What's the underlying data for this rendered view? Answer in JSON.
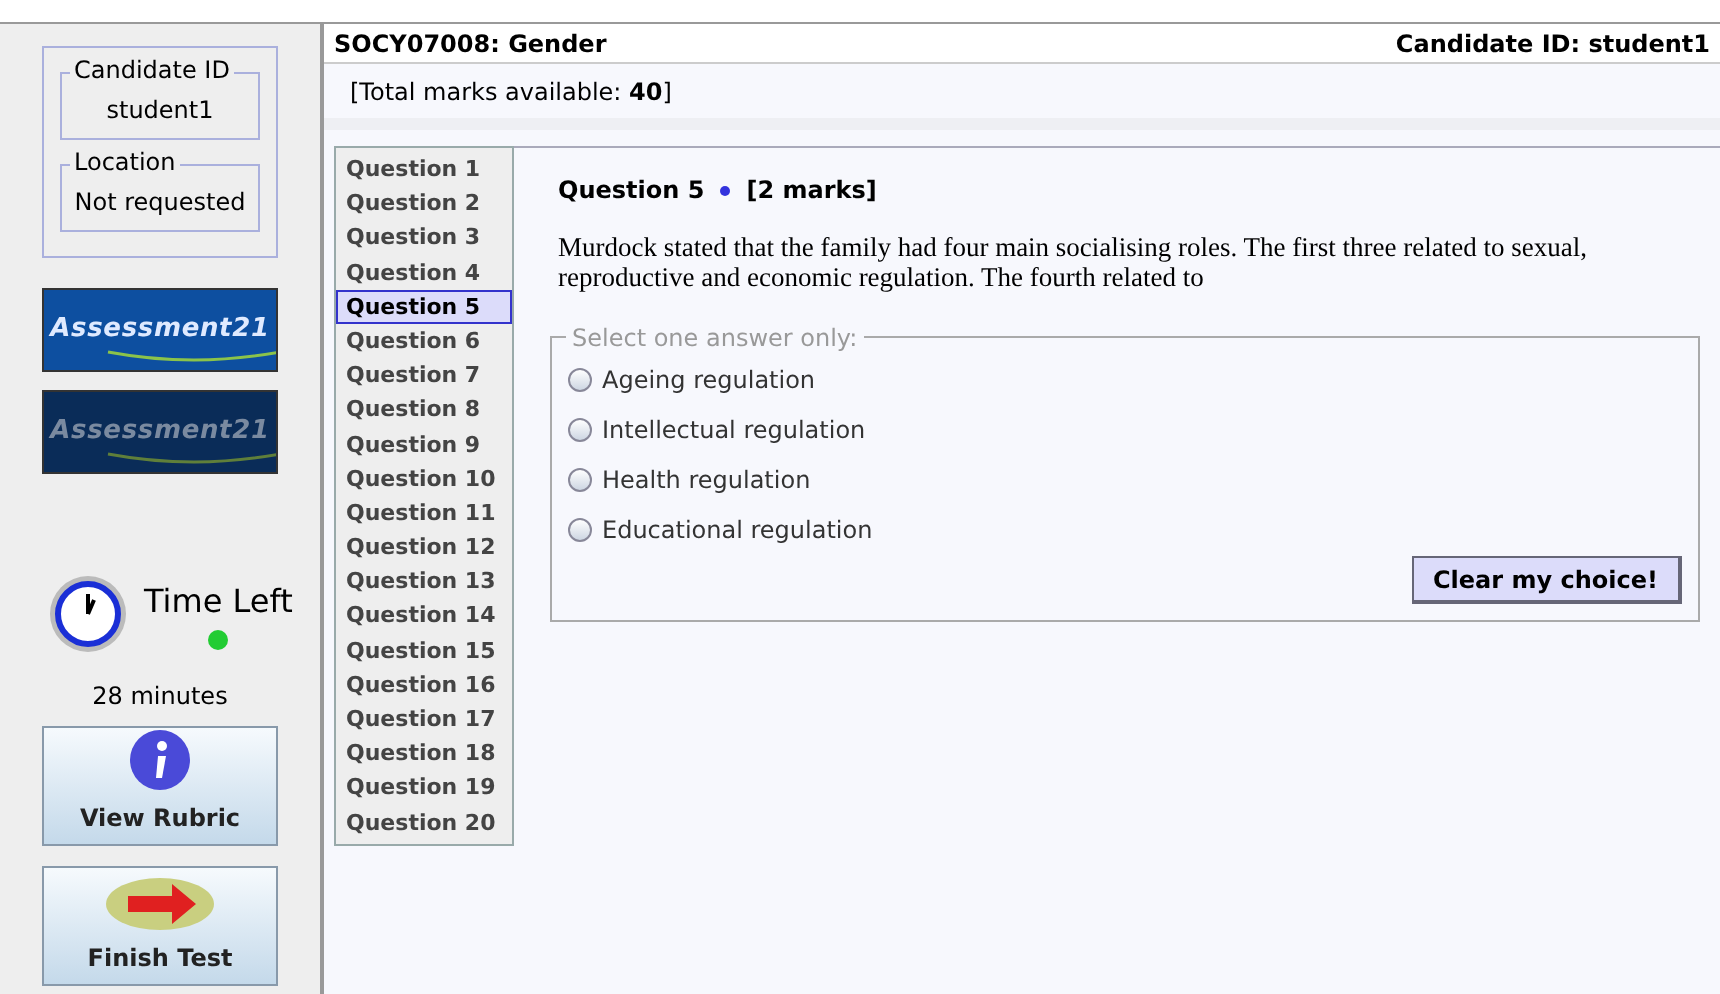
{
  "sidebar": {
    "candidate": {
      "legend": "Candidate ID",
      "value": "student1"
    },
    "location": {
      "legend": "Location",
      "value": "Not requested"
    },
    "logos": [
      {
        "text": "Assessment21",
        "active": true
      },
      {
        "text": "Assessment21",
        "active": false
      }
    ],
    "timer": {
      "label": "Time Left",
      "running": true,
      "remaining": "28 minutes"
    },
    "buttons": [
      {
        "kind": "info",
        "label": "View Rubric"
      },
      {
        "kind": "finish",
        "label": "Finish Test"
      }
    ]
  },
  "header": {
    "title": "SOCY07008: Gender",
    "candidate": "Candidate ID: student1"
  },
  "total_marks": {
    "prefix": "[Total marks available: ",
    "value": "40",
    "suffix": "]"
  },
  "questions": [
    {
      "label": "Question 1",
      "selected": false
    },
    {
      "label": "Question 2",
      "selected": false
    },
    {
      "label": "Question 3",
      "selected": false
    },
    {
      "label": "Question 4",
      "selected": false
    },
    {
      "label": "Question 5",
      "selected": true
    },
    {
      "label": "Question 6",
      "selected": false
    },
    {
      "label": "Question 7",
      "selected": false
    },
    {
      "label": "Question 8",
      "selected": false
    },
    {
      "label": "Question 9",
      "selected": false
    },
    {
      "label": "Question 10",
      "selected": false
    },
    {
      "label": "Question 11",
      "selected": false
    },
    {
      "label": "Question 12",
      "selected": false
    },
    {
      "label": "Question 13",
      "selected": false
    },
    {
      "label": "Question 14",
      "selected": false
    },
    {
      "label": "Question 15",
      "selected": false
    },
    {
      "label": "Question 16",
      "selected": false
    },
    {
      "label": "Question 17",
      "selected": false
    },
    {
      "label": "Question 18",
      "selected": false
    },
    {
      "label": "Question 19",
      "selected": false
    },
    {
      "label": "Question 20",
      "selected": false
    }
  ],
  "question": {
    "title": "Question 5",
    "marks": "[2 marks]",
    "text": "Murdock stated that the family had four main socialising roles. The first three related to sexual, reproductive and economic regulation. The fourth related to",
    "legend": "Select one answer only:",
    "options": [
      {
        "label": "Ageing regulation",
        "selected": false
      },
      {
        "label": "Intellectual regulation",
        "selected": false
      },
      {
        "label": "Health regulation",
        "selected": false
      },
      {
        "label": "Educational regulation",
        "selected": false
      }
    ],
    "clear_button": "Clear my choice!"
  }
}
